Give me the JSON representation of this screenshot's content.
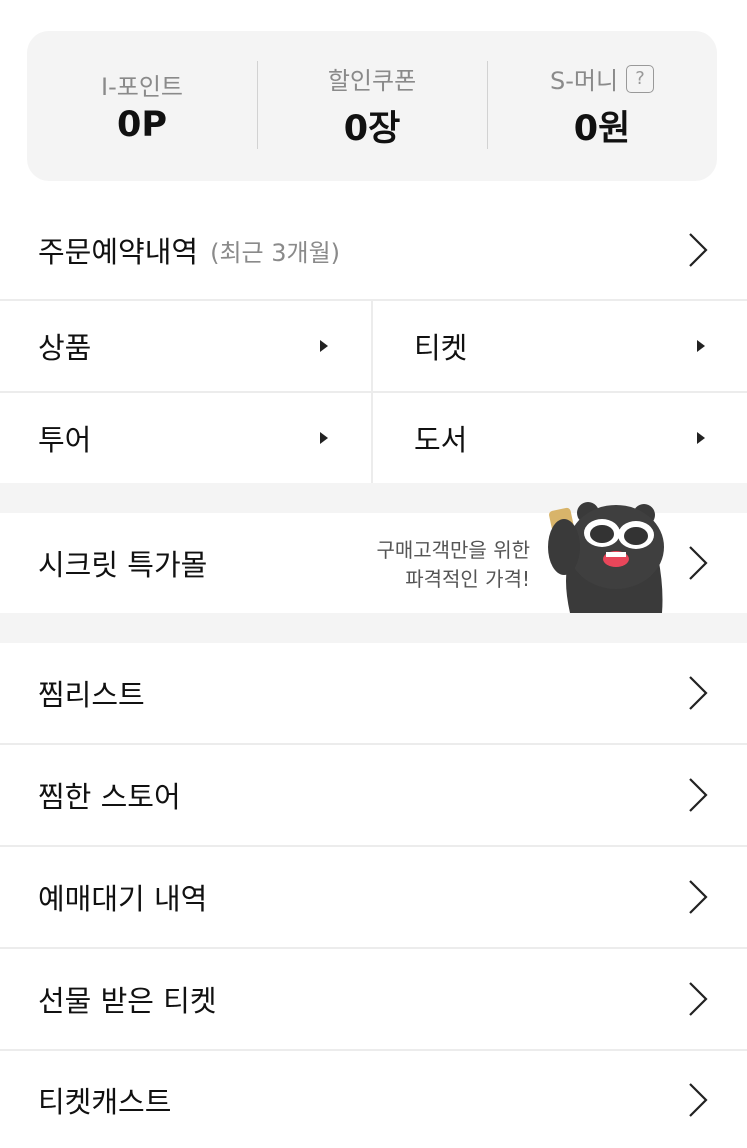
{
  "summary": {
    "points": {
      "label": "I-포인트",
      "value": "0P"
    },
    "coupons": {
      "label": "할인쿠폰",
      "value": "0장"
    },
    "smoney": {
      "label": "S-머니",
      "help": "?",
      "value": "0원"
    }
  },
  "orders": {
    "title": "주문예약내역",
    "sub": "(최근 3개월)"
  },
  "categories": {
    "goods": "상품",
    "ticket": "티켓",
    "tour": "투어",
    "books": "도서"
  },
  "secret": {
    "title": "시크릿 특가몰",
    "promo_line1": "구매고객만을 위한",
    "promo_line2": "파격적인 가격!"
  },
  "menu": {
    "wishlist": "찜리스트",
    "stores": "찜한 스토어",
    "waitlist": "예매대기 내역",
    "gift": "선물 받은 티켓",
    "ticketcast": "티켓캐스트"
  }
}
